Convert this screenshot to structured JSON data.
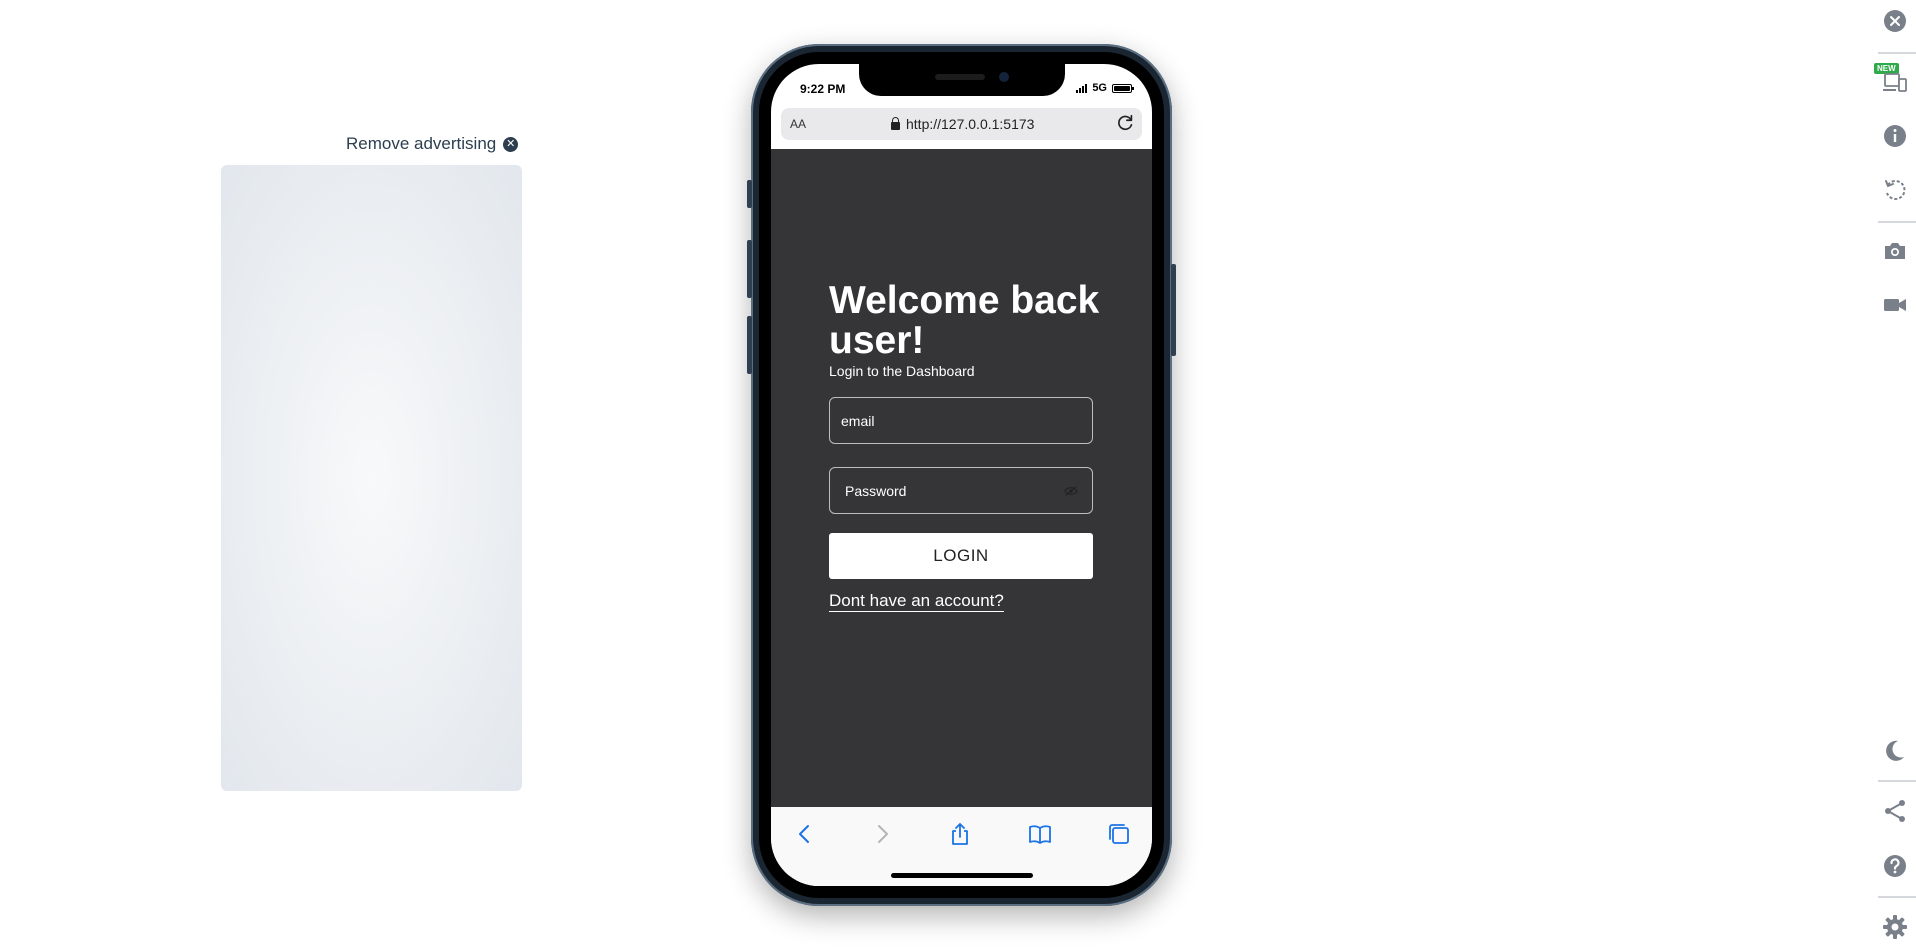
{
  "ad": {
    "remove_label": "Remove advertising"
  },
  "phone": {
    "status": {
      "time": "9:22 PM",
      "network": "5G"
    },
    "browser": {
      "text_size": "AA",
      "url": "http://127.0.0.1:5173"
    },
    "login": {
      "title": "Welcome back user!",
      "subtitle": "Login to the Dashboard",
      "email_placeholder": "email",
      "password_placeholder": "Password",
      "login_button": "LOGIN",
      "signup_link": "Dont have an account?"
    }
  },
  "rail": {
    "new_badge": "NEW"
  },
  "icons": {
    "close": "close-icon",
    "device": "device-icon",
    "info": "info-icon",
    "rotate": "rotate-icon",
    "screenshot": "camera-icon",
    "record": "video-icon",
    "dark_mode": "moon-icon",
    "share": "share-icon",
    "help": "help-icon",
    "settings": "gear-icon"
  },
  "colors": {
    "app_background": "#353538",
    "accent": "#1a73e8",
    "rail_icon": "#7a808a",
    "badge": "#2eaa4a"
  }
}
